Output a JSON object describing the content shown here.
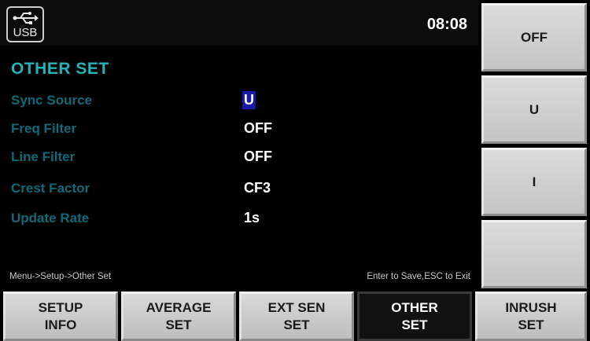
{
  "statusbar": {
    "usb_label": "USB",
    "clock": "08:08"
  },
  "page": {
    "title": "OTHER SET",
    "params": [
      {
        "label": "Sync Source",
        "value": "U",
        "selected": true
      },
      {
        "label": "Freq Filter",
        "value": "OFF",
        "selected": false
      },
      {
        "label": "Line Filter",
        "value": "OFF",
        "selected": false
      },
      {
        "label": "Crest Factor",
        "value": "CF3",
        "selected": false
      },
      {
        "label": "Update Rate",
        "value": "1s",
        "selected": false
      }
    ],
    "breadcrumb": "Menu->Setup->Other Set",
    "hint": "Enter to Save,ESC to Exit"
  },
  "softkeys": [
    "OFF",
    "U",
    "I",
    ""
  ],
  "tabs": [
    {
      "line1": "SETUP",
      "line2": "INFO",
      "active": false
    },
    {
      "line1": "AVERAGE",
      "line2": "SET",
      "active": false
    },
    {
      "line1": "EXT SEN",
      "line2": "SET",
      "active": false
    },
    {
      "line1": "OTHER",
      "line2": "SET",
      "active": true
    },
    {
      "line1": "INRUSH",
      "line2": "SET",
      "active": false
    }
  ],
  "colors": {
    "title": "#23b3b8",
    "label": "#0f6a78",
    "selection": "#1a1aa8"
  }
}
